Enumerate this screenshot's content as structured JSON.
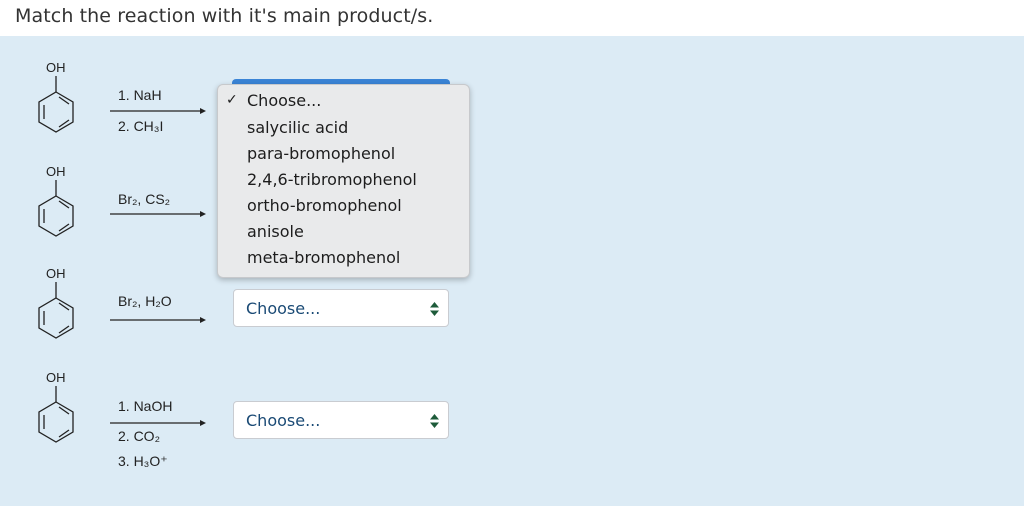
{
  "question": "Match the reaction with it's main product/s.",
  "molecule_label": "OH",
  "reactions": [
    {
      "lines": [
        {
          "text": "1. NaH"
        },
        {
          "text": "2. CH₃I"
        }
      ]
    },
    {
      "lines": [
        {
          "text": "Br₂, CS₂"
        }
      ]
    },
    {
      "lines": [
        {
          "text": "Br₂, H₂O"
        }
      ]
    },
    {
      "lines": [
        {
          "text": "1. NaOH"
        },
        {
          "text": "2. CO₂"
        },
        {
          "text": "3. H₃O⁺"
        }
      ]
    }
  ],
  "dropdown": {
    "options": [
      "Choose...",
      "salycilic acid",
      "para-bromophenol",
      "2,4,6-tribromophenol",
      "ortho-bromophenol",
      "anisole",
      "meta-bromophenol"
    ],
    "selected": "Choose...",
    "check": "✓"
  },
  "selects": [
    {
      "value": "Choose..."
    },
    {
      "value": "Choose..."
    }
  ],
  "colors": {
    "background": "#dcebf5",
    "select_text": "#1a4a75",
    "arrow_icon": "#1e5b3a",
    "focus_ring": "#3a84d6"
  }
}
